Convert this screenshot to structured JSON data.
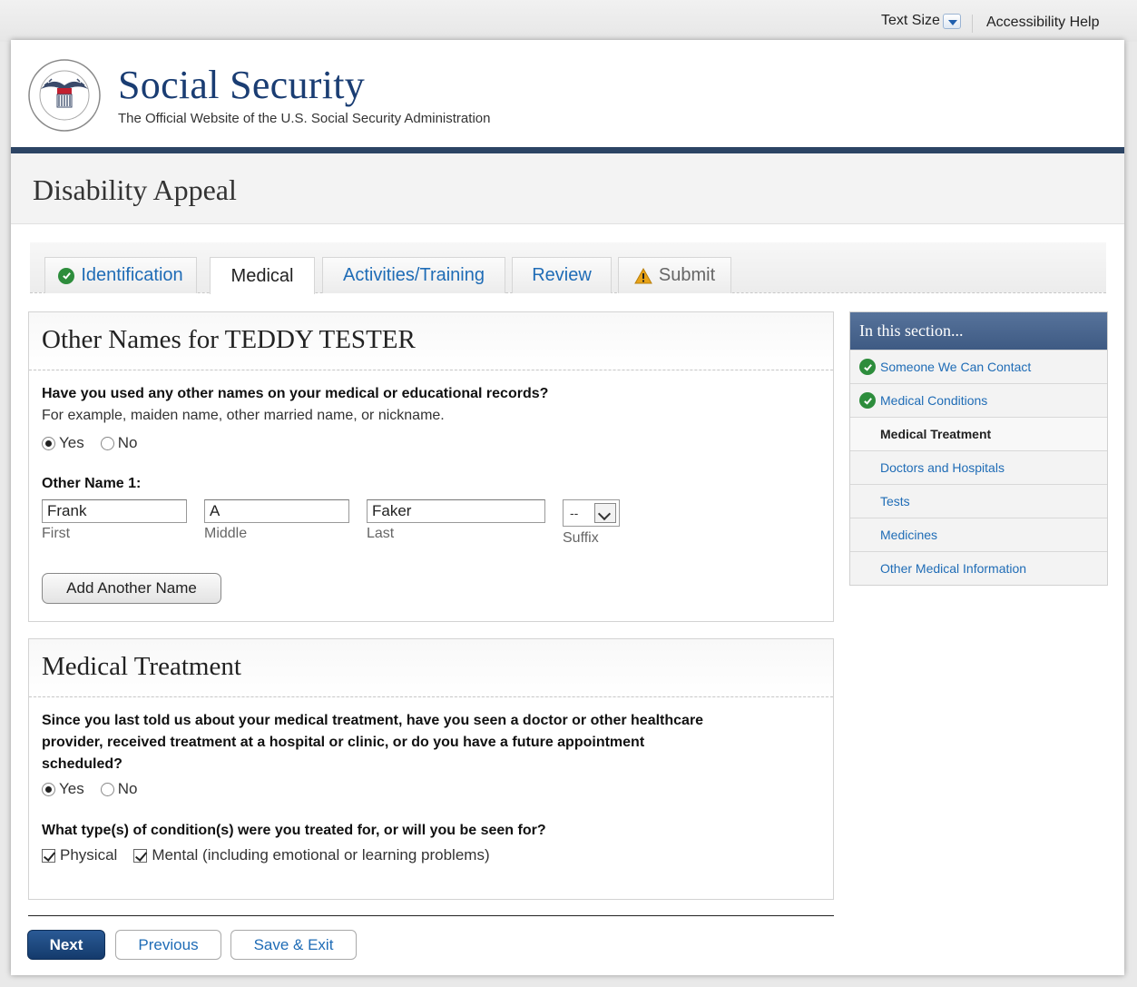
{
  "utility": {
    "text_size": "Text Size",
    "accessibility_help": "Accessibility Help"
  },
  "header": {
    "brand_title": "Social Security",
    "brand_subtitle": "The Official Website of the U.S. Social Security Administration",
    "seal_text": "SOCIAL SECURITY ADMINISTRATION USA"
  },
  "page_title": "Disability Appeal",
  "tabs": [
    {
      "label": "Identification",
      "state": "complete"
    },
    {
      "label": "Medical",
      "state": "active"
    },
    {
      "label": "Activities/Training",
      "state": "link"
    },
    {
      "label": "Review",
      "state": "link"
    },
    {
      "label": "Submit",
      "state": "warning"
    }
  ],
  "other_names": {
    "heading": "Other Names for TEDDY TESTER",
    "question": "Have you used any other names on your medical or educational records?",
    "hint": "For example, maiden name, other married name, or nickname.",
    "yes": "Yes",
    "no": "No",
    "selected": "Yes",
    "name_label": "Other Name 1:",
    "first_value": "Frank",
    "first_label": "First",
    "middle_value": "A",
    "middle_label": "Middle",
    "last_value": "Faker",
    "last_label": "Last",
    "suffix_value": "--",
    "suffix_label": "Suffix",
    "add_button": "Add Another Name"
  },
  "medical_treatment": {
    "heading": "Medical Treatment",
    "question_lines": [
      "Since you last told us about your medical treatment, have you seen a doctor or other healthcare",
      "provider, received treatment at a hospital or clinic, or do you have a future appointment",
      "scheduled?"
    ],
    "yes": "Yes",
    "no": "No",
    "selected": "Yes",
    "condition_question": "What type(s) of condition(s) were you treated for, or will you be seen for?",
    "physical_label": "Physical",
    "physical_checked": true,
    "mental_label": "Mental (including emotional or learning problems)",
    "mental_checked": true
  },
  "sidebar": {
    "heading": "In this section...",
    "items": [
      {
        "label": "Someone We Can Contact",
        "state": "complete"
      },
      {
        "label": "Medical Conditions",
        "state": "complete"
      },
      {
        "label": "Medical Treatment",
        "state": "current"
      },
      {
        "label": "Doctors and Hospitals",
        "state": "link"
      },
      {
        "label": "Tests",
        "state": "link"
      },
      {
        "label": "Medicines",
        "state": "link"
      },
      {
        "label": "Other Medical Information",
        "state": "link"
      }
    ]
  },
  "footer": {
    "next": "Next",
    "previous": "Previous",
    "save_exit": "Save & Exit"
  },
  "colors": {
    "brand_navy": "#1a3d73",
    "link_blue": "#1f6cb6",
    "success_green": "#2d8d3c",
    "warning_amber": "#e8a317"
  }
}
